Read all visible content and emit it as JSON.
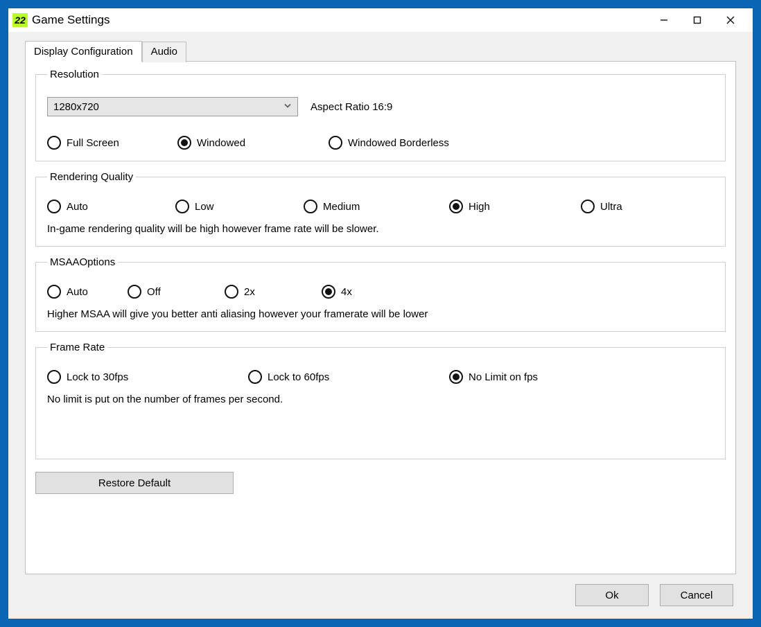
{
  "window": {
    "icon_text": "22",
    "title": "Game Settings"
  },
  "tabs": {
    "display": "Display Configuration",
    "audio": "Audio"
  },
  "resolution": {
    "legend": "Resolution",
    "selected": "1280x720",
    "aspect_label": "Aspect Ratio 16:9",
    "modes": {
      "fullscreen": "Full Screen",
      "windowed": "Windowed",
      "borderless": "Windowed Borderless"
    },
    "selected_mode": "windowed"
  },
  "rendering": {
    "legend": "Rendering Quality",
    "options": {
      "auto": "Auto",
      "low": "Low",
      "medium": "Medium",
      "high": "High",
      "ultra": "Ultra"
    },
    "selected": "high",
    "helper": "In-game rendering quality will be high however frame rate will be slower."
  },
  "msaa": {
    "legend": "MSAAOptions",
    "options": {
      "auto": "Auto",
      "off": "Off",
      "x2": "2x",
      "x4": "4x"
    },
    "selected": "x4",
    "helper": "Higher MSAA will give you better anti aliasing however your framerate will be lower"
  },
  "framerate": {
    "legend": "Frame Rate",
    "options": {
      "lock30": "Lock  to 30fps",
      "lock60": "Lock to 60fps",
      "nolimit": "No Limit on fps"
    },
    "selected": "nolimit",
    "helper": "No limit is put on the number of frames per second."
  },
  "buttons": {
    "restore": "Restore Default",
    "ok": "Ok",
    "cancel": "Cancel"
  }
}
